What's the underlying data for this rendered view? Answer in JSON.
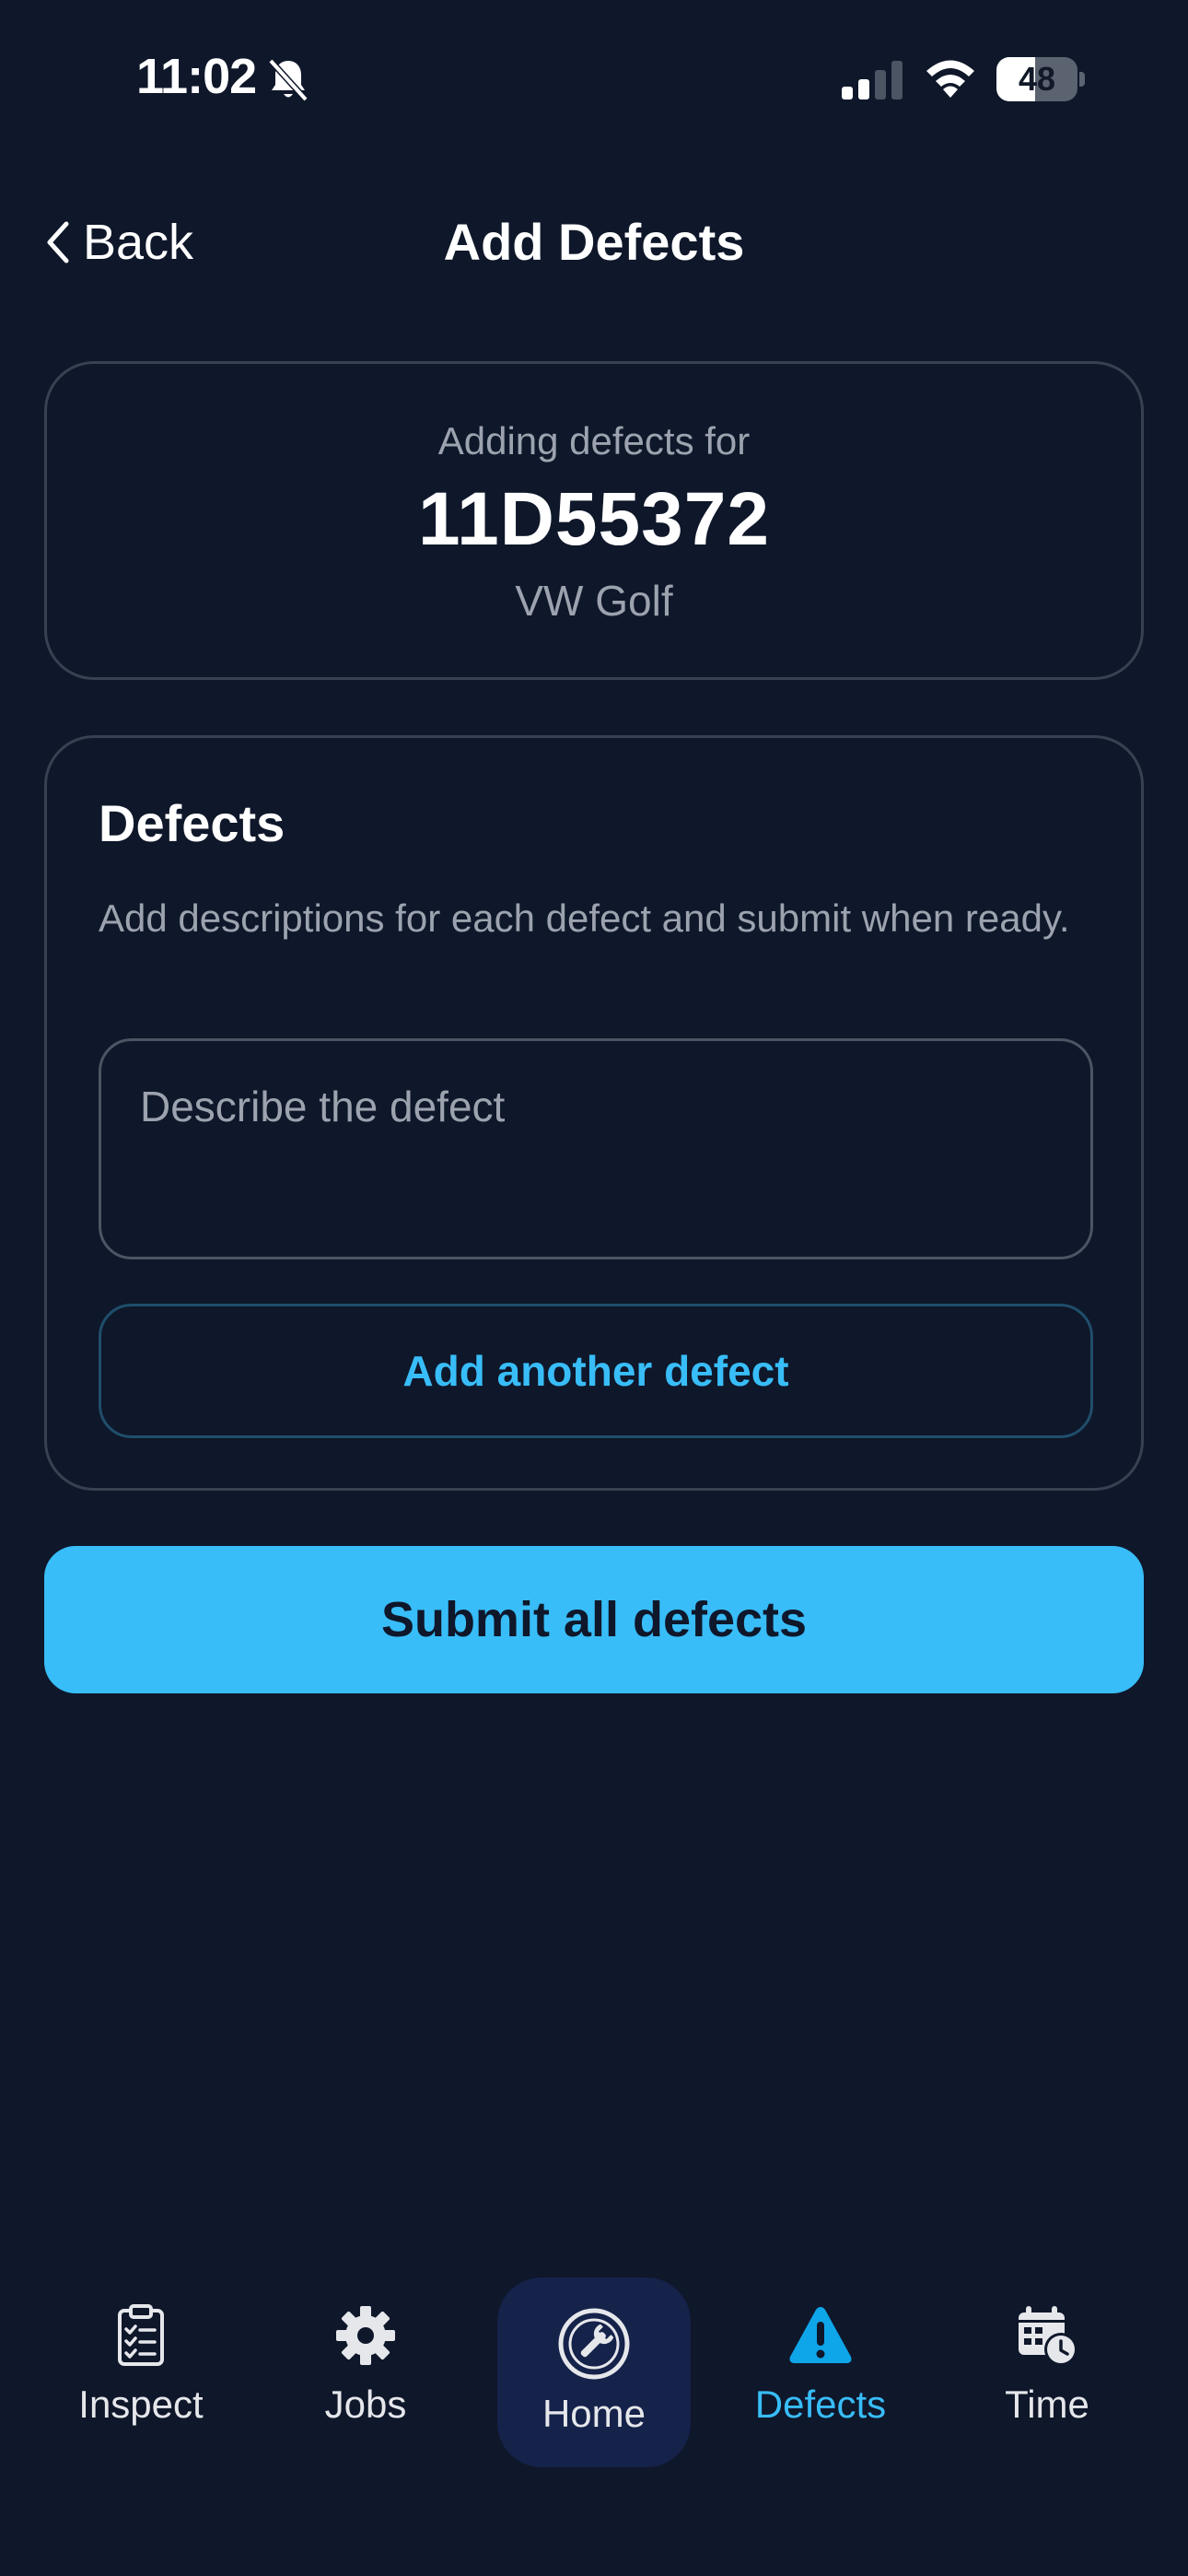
{
  "status_bar": {
    "time": "11:02",
    "battery_level": "48",
    "battery_fraction": 0.48,
    "icons": [
      "bell-off-icon",
      "signal-icon",
      "wifi-icon",
      "battery-icon"
    ]
  },
  "header": {
    "back_label": "Back",
    "title": "Add Defects"
  },
  "vehicle": {
    "subtitle": "Adding defects for",
    "registration": "11D55372",
    "model": "VW Golf"
  },
  "defects": {
    "heading": "Defects",
    "description": "Add descriptions for each defect and submit when ready.",
    "input_placeholder": "Describe the defect",
    "input_value": "",
    "add_button_label": "Add another defect"
  },
  "submit_label": "Submit all defects",
  "tab_bar": {
    "tabs": [
      {
        "label": "Inspect",
        "icon": "clipboard-checklist-icon",
        "active": false
      },
      {
        "label": "Jobs",
        "icon": "gear-icon",
        "active": false
      },
      {
        "label": "Home",
        "icon": "wrench-circle-icon",
        "active": false
      },
      {
        "label": "Defects",
        "icon": "warning-triangle-icon",
        "active": true
      },
      {
        "label": "Time",
        "icon": "calendar-clock-icon",
        "active": false
      }
    ]
  },
  "colors": {
    "background": "#0f172a",
    "accent": "#38bdf8",
    "card_border": "#374151",
    "muted_text": "#9ca3af",
    "home_tab_bg": "#15224a"
  }
}
